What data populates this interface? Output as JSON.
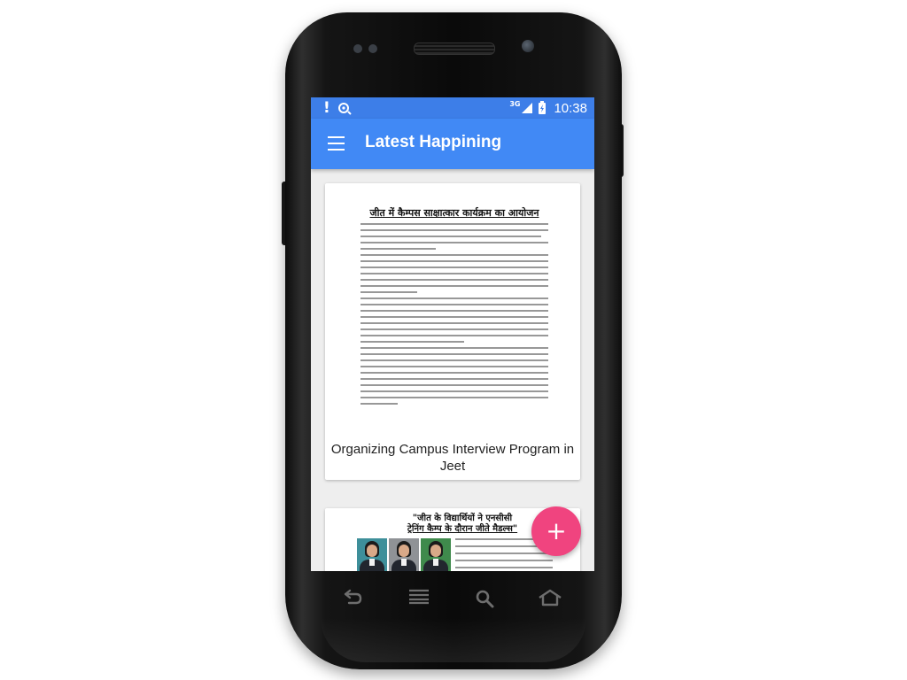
{
  "status_bar": {
    "icons": [
      "alert-icon",
      "sync-icon",
      "signal-icon",
      "battery-icon"
    ],
    "network": "3G",
    "time": "10:38",
    "color": "#3d7ee8"
  },
  "app_bar": {
    "title": "Latest Happining",
    "menu_icon": "menu-icon",
    "color": "#4189f5"
  },
  "feed": {
    "items": [
      {
        "headline": "जीत में कैम्पस साक्षात्कार कार्यक्रम का आयोजन",
        "title": "Organizing Campus Interview Program in Jeet"
      },
      {
        "headline_line1": "\"जीत के विद्यार्थियों ने एनसीसी",
        "headline_line2": "ट्रेनिंग कैम्प के दौरान जीते मैडल्स\"",
        "photo_count": 3
      }
    ]
  },
  "fab": {
    "label": "+",
    "color": "#f0447f"
  },
  "nav_keys": [
    "back-icon",
    "menu-lines-icon",
    "search-icon",
    "home-icon"
  ]
}
